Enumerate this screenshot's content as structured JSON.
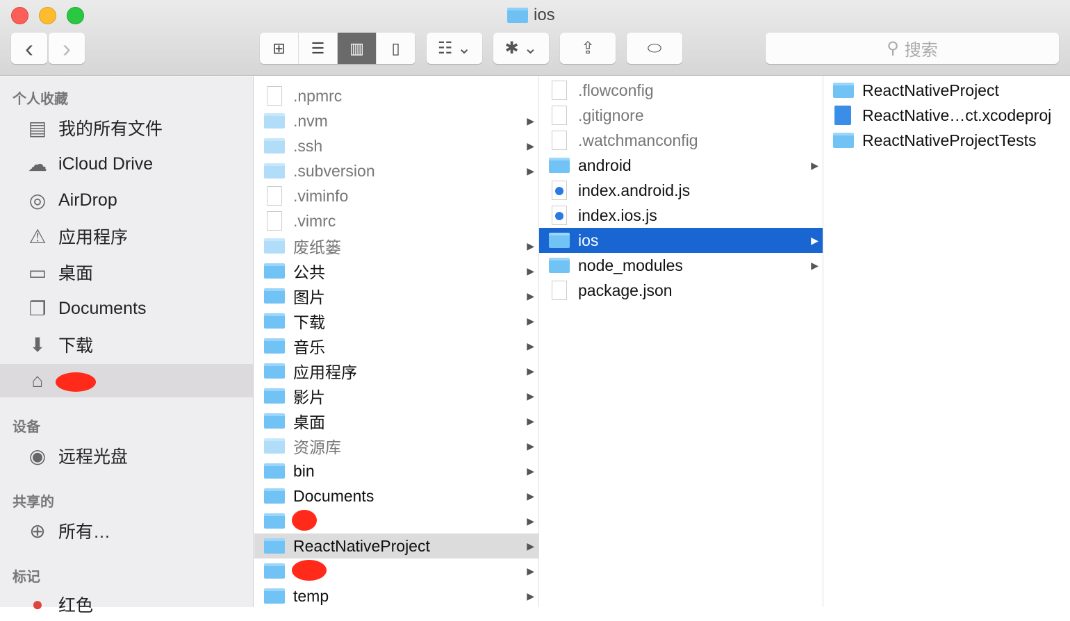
{
  "window": {
    "title": "ios"
  },
  "toolbar": {
    "back": "‹",
    "forward": "›",
    "views": [
      "⊞",
      "☰",
      "▥",
      "▯"
    ],
    "arrange": "☷ ⌄",
    "action": "✱ ⌄",
    "share": "⇪",
    "tags": "⬭",
    "search_placeholder": "搜索"
  },
  "sidebar": {
    "sections": [
      {
        "label": "个人收藏"
      },
      {
        "label": "设备"
      },
      {
        "label": "共享的"
      },
      {
        "label": "标记"
      }
    ],
    "favorites": [
      {
        "label": "我的所有文件",
        "icon": "all-files-icon"
      },
      {
        "label": "iCloud Drive",
        "icon": "cloud-icon"
      },
      {
        "label": "AirDrop",
        "icon": "airdrop-icon"
      },
      {
        "label": "应用程序",
        "icon": "applications-icon"
      },
      {
        "label": "桌面",
        "icon": "desktop-icon"
      },
      {
        "label": "Documents",
        "icon": "documents-icon"
      },
      {
        "label": "下载",
        "icon": "download-icon"
      }
    ],
    "devices": [
      {
        "label": "远程光盘"
      }
    ],
    "shared": [
      {
        "label": "所有…"
      }
    ],
    "tags": [
      {
        "label": "红色",
        "color": "#e0443e"
      }
    ]
  },
  "columns": [
    {
      "items": [
        {
          "name": ".npmrc",
          "type": "doc",
          "dim": true
        },
        {
          "name": ".nvm",
          "type": "folder",
          "dim": true,
          "arrow": true
        },
        {
          "name": ".ssh",
          "type": "folder",
          "dim": true,
          "arrow": true
        },
        {
          "name": ".subversion",
          "type": "folder",
          "dim": true,
          "arrow": true
        },
        {
          "name": ".viminfo",
          "type": "doc",
          "dim": true
        },
        {
          "name": ".vimrc",
          "type": "doc",
          "dim": true
        },
        {
          "name": "废纸篓",
          "type": "folder",
          "dim": true,
          "arrow": true
        },
        {
          "name": "公共",
          "type": "folder",
          "arrow": true
        },
        {
          "name": "图片",
          "type": "folder",
          "arrow": true
        },
        {
          "name": "下载",
          "type": "folder",
          "arrow": true
        },
        {
          "name": "音乐",
          "type": "folder",
          "arrow": true
        },
        {
          "name": "应用程序",
          "type": "folder",
          "arrow": true
        },
        {
          "name": "影片",
          "type": "folder",
          "arrow": true
        },
        {
          "name": "桌面",
          "type": "folder",
          "arrow": true
        },
        {
          "name": "资源库",
          "type": "folder",
          "dim": true,
          "arrow": true
        },
        {
          "name": "bin",
          "type": "folder",
          "arrow": true
        },
        {
          "name": "Documents",
          "type": "folder",
          "arrow": true
        },
        {
          "name": "",
          "type": "folder",
          "arrow": true,
          "redacted": true
        },
        {
          "name": "ReactNativeProject",
          "type": "folder",
          "arrow": true,
          "state": "gsel"
        },
        {
          "name": "",
          "type": "folder",
          "arrow": true,
          "redacted": true
        },
        {
          "name": "temp",
          "type": "folder",
          "arrow": true
        }
      ]
    },
    {
      "items": [
        {
          "name": ".flowconfig",
          "type": "doc",
          "dim": true
        },
        {
          "name": ".gitignore",
          "type": "doc",
          "dim": true
        },
        {
          "name": ".watchmanconfig",
          "type": "doc",
          "dim": true
        },
        {
          "name": "android",
          "type": "folder",
          "arrow": true
        },
        {
          "name": "index.android.js",
          "type": "js"
        },
        {
          "name": "index.ios.js",
          "type": "js"
        },
        {
          "name": "ios",
          "type": "folder",
          "arrow": true,
          "state": "sel"
        },
        {
          "name": "node_modules",
          "type": "folder",
          "arrow": true
        },
        {
          "name": "package.json",
          "type": "doc"
        }
      ]
    },
    {
      "items": [
        {
          "name": "ReactNativeProject",
          "type": "folder"
        },
        {
          "name": "ReactNative…ct.xcodeproj",
          "type": "xc"
        },
        {
          "name": "ReactNativeProjectTests",
          "type": "folder"
        }
      ]
    }
  ]
}
